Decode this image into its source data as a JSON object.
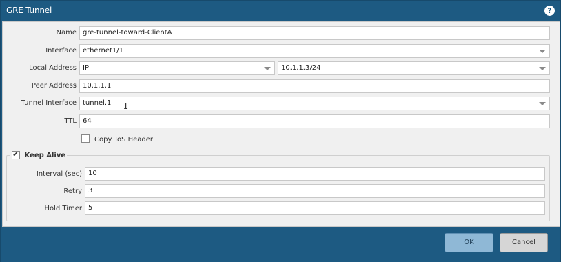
{
  "dialog": {
    "title": "GRE Tunnel",
    "help_icon": "help-icon"
  },
  "form": {
    "name": {
      "label": "Name",
      "value": "gre-tunnel-toward-ClientA"
    },
    "interface": {
      "label": "Interface",
      "value": "ethernet1/1"
    },
    "local_address": {
      "label": "Local Address",
      "type_value": "IP",
      "ip_value": "10.1.1.3/24"
    },
    "peer_address": {
      "label": "Peer Address",
      "value": "10.1.1.1"
    },
    "tunnel_interface": {
      "label": "Tunnel Interface",
      "value": "tunnel.1"
    },
    "ttl": {
      "label": "TTL",
      "value": "64"
    },
    "copy_tos": {
      "label": "Copy ToS Header",
      "checked": false
    }
  },
  "keep_alive": {
    "label": "Keep Alive",
    "checked": true,
    "interval": {
      "label": "Interval (sec)",
      "value": "10"
    },
    "retry": {
      "label": "Retry",
      "value": "3"
    },
    "hold_timer": {
      "label": "Hold Timer",
      "value": "5"
    }
  },
  "buttons": {
    "ok": "OK",
    "cancel": "Cancel"
  },
  "colors": {
    "titlebar": "#1d5a82",
    "panel": "#f0f0f0",
    "ok_button": "#8fb8d6"
  }
}
